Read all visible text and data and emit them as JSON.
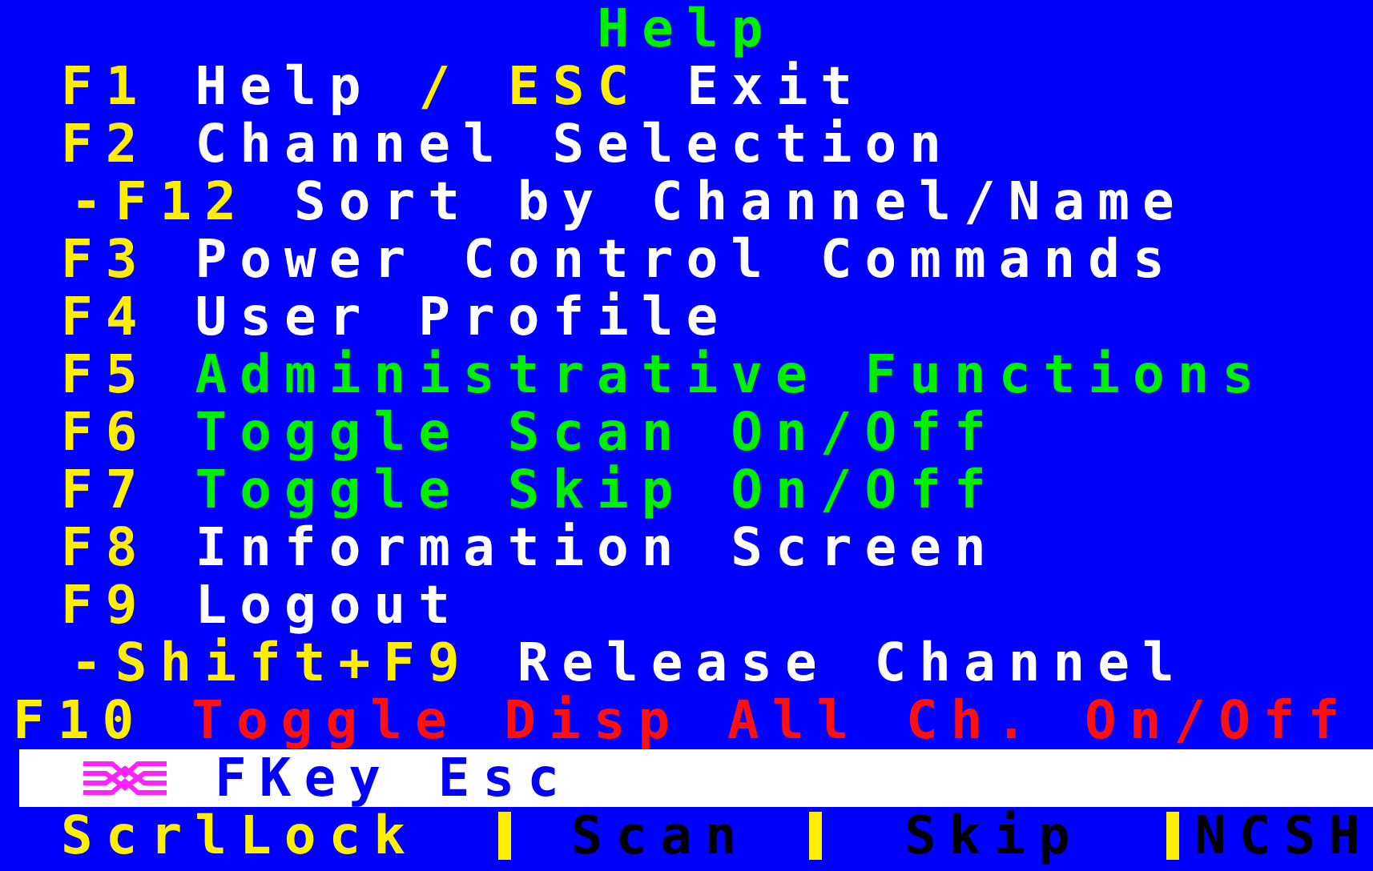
{
  "title": "Help",
  "lines": [
    {
      "kind": "main",
      "segments": [
        {
          "kind": "key",
          "text": "F1"
        },
        {
          "kind": "text",
          "text": "Help"
        },
        {
          "kind": "key",
          "text": "/ ESC"
        },
        {
          "kind": "text",
          "text": "Exit"
        }
      ]
    },
    {
      "kind": "main",
      "segments": [
        {
          "kind": "key",
          "text": "F2"
        },
        {
          "kind": "text",
          "text": "Channel Selection"
        }
      ]
    },
    {
      "kind": "sub",
      "segments": [
        {
          "kind": "key",
          "text": "-F12"
        },
        {
          "kind": "text",
          "text": "Sort by Channel/Name"
        }
      ]
    },
    {
      "kind": "main",
      "segments": [
        {
          "kind": "key",
          "text": "F3"
        },
        {
          "kind": "text",
          "text": "Power Control Commands"
        }
      ]
    },
    {
      "kind": "main",
      "segments": [
        {
          "kind": "key",
          "text": "F4"
        },
        {
          "kind": "text",
          "text": "User Profile"
        }
      ]
    },
    {
      "kind": "main",
      "segments": [
        {
          "kind": "key",
          "text": "F5"
        },
        {
          "kind": "admin",
          "text": "Administrative Functions"
        }
      ]
    },
    {
      "kind": "main",
      "segments": [
        {
          "kind": "key",
          "text": "F6"
        },
        {
          "kind": "admin",
          "text": "Toggle Scan On/Off"
        }
      ]
    },
    {
      "kind": "main",
      "segments": [
        {
          "kind": "key",
          "text": "F7"
        },
        {
          "kind": "admin",
          "text": "Toggle Skip On/Off"
        }
      ]
    },
    {
      "kind": "main",
      "segments": [
        {
          "kind": "key",
          "text": "F8"
        },
        {
          "kind": "text",
          "text": "Information Screen"
        }
      ]
    },
    {
      "kind": "main",
      "segments": [
        {
          "kind": "key",
          "text": "F9"
        },
        {
          "kind": "text",
          "text": "Logout"
        }
      ]
    },
    {
      "kind": "sub",
      "segments": [
        {
          "kind": "key",
          "text": "-Shift+F9"
        },
        {
          "kind": "text",
          "text": "Release Channel"
        }
      ]
    },
    {
      "kind": "full",
      "segments": [
        {
          "kind": "key",
          "text": "F10"
        },
        {
          "kind": "warn",
          "text": "Toggle Disp All Ch. On/Off"
        }
      ]
    }
  ],
  "status_line": {
    "text": "FKey Esc"
  },
  "indicators": [
    {
      "label": "ScrlLock",
      "on": true
    },
    {
      "label": "Scan",
      "on": false
    },
    {
      "label": "Skip",
      "on": false
    },
    {
      "label": "NCSH",
      "on": false
    }
  ]
}
